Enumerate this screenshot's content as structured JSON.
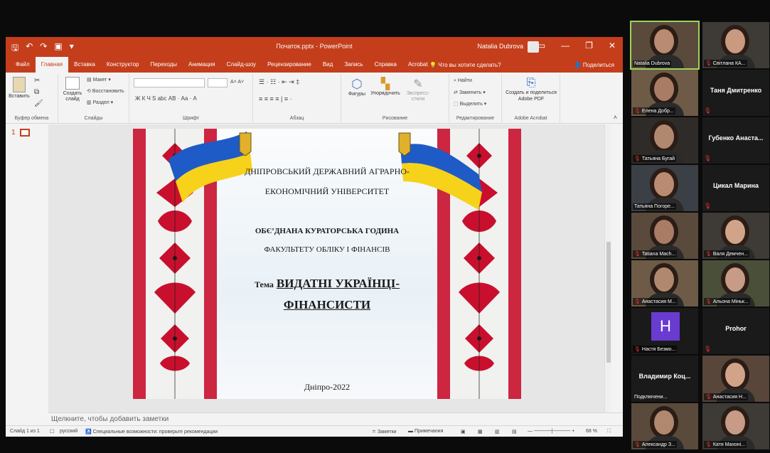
{
  "window": {
    "filename": "Початок.pptx - PowerPoint",
    "user": "Natalia Dubrova"
  },
  "menu": {
    "tabs": [
      "Файл",
      "Главная",
      "Вставка",
      "Конструктор",
      "Переходы",
      "Анимация",
      "Слайд-шоу",
      "Рецензирование",
      "Вид",
      "Запись",
      "Справка",
      "Acrobat"
    ],
    "active_tab": "Главная",
    "tell_me": "Что вы хотите сделать?",
    "share": "Поделиться"
  },
  "ribbon": {
    "clipboard": {
      "paste": "Вставить",
      "label": "Буфер обмена"
    },
    "slides": {
      "new_slide": "Создать слайд",
      "layout": "Макет",
      "reset": "Восстановить",
      "section": "Раздел",
      "label": "Слайды"
    },
    "font": {
      "label": "Шрифт",
      "buttons": "Ж  К  Ч  S  abc  АВ  ·  Аа  ·  А"
    },
    "paragraph": {
      "label": "Абзац"
    },
    "drawing": {
      "shapes": "Фигуры",
      "arrange": "Упорядочить",
      "quick_styles": "Экспресс-стили",
      "label": "Рисование"
    },
    "editing": {
      "find": "Найти",
      "replace": "Заменить",
      "select": "Выделить",
      "label": "Редактирование"
    },
    "acrobat": {
      "create_share": "Создать и поделиться Adobe PDF",
      "label": "Adobe Acrobat"
    }
  },
  "slide": {
    "number": "1",
    "university_line1": "ДНІПРОВСЬКИЙ ДЕРЖАВНИЙ АГРАРНО-",
    "university_line2": "ЕКОНОМІЧНИЙ УНІВЕРСИТЕТ",
    "event": "ОБЄ’ДНАНА КУРАТОРСЬКА ГОДИНА",
    "faculty": "ФАКУЛЬТЕТУ ОБЛІКУ І ФІНАНСІВ",
    "topic_label": "Тема",
    "topic_line1": "ВИДАТНІ УКРАЇНЦІ-",
    "topic_line2": "ФІНАНСИСТИ",
    "city_year": "Дніпро-2022"
  },
  "notes_placeholder": "Щелкните, чтобы добавить заметки",
  "status": {
    "slide_of": "Слайд 1 из 1",
    "language": "русский",
    "accessibility": "Специальные возможности: проверьте рекомендации",
    "notes": "Заметки",
    "comments": "Примечания",
    "zoom": "68 %"
  },
  "participants": [
    {
      "name": "Natalia Dubrova",
      "video": true,
      "active": true
    },
    {
      "name": "Світлана КА...",
      "video": true,
      "muted": true
    },
    {
      "name": "Елена Добр...",
      "video": true,
      "muted": true
    },
    {
      "name": "Таня Дмитренко",
      "video": false
    },
    {
      "name": "Татьяна Бугай",
      "video": true,
      "muted": true
    },
    {
      "name": "Губенко Анаста...",
      "video": false
    },
    {
      "name": "Татьяна Погоре...",
      "video": true
    },
    {
      "name": "Цикал Марина",
      "video": false
    },
    {
      "name": "Tatiana Mach...",
      "video": true,
      "muted": true
    },
    {
      "name": "Валя Демчен...",
      "video": true,
      "muted": true
    },
    {
      "name": "Анастасия М...",
      "video": true,
      "muted": true
    },
    {
      "name": "Альона Міньк...",
      "video": true,
      "muted": true
    },
    {
      "name": "Настя Безмо...",
      "video": false,
      "avatar_letter": "H",
      "muted": true
    },
    {
      "name": "Prohor",
      "video": false
    },
    {
      "name": "Владимир Коц...",
      "video": false,
      "status": "Подключени..."
    },
    {
      "name": "Анастасия Н...",
      "video": true,
      "muted": true
    },
    {
      "name": "Александр З...",
      "video": true,
      "muted": true
    },
    {
      "name": "Катя Махоні...",
      "video": true,
      "muted": true
    }
  ],
  "colors": {
    "ppt_accent": "#c43e1c",
    "ornament_red": "#c8102e",
    "flag_blue": "#1e5bc6",
    "flag_yellow": "#f6d21a",
    "active_speaker": "#9fd35b",
    "avatar_purple": "#6a3bd1"
  }
}
